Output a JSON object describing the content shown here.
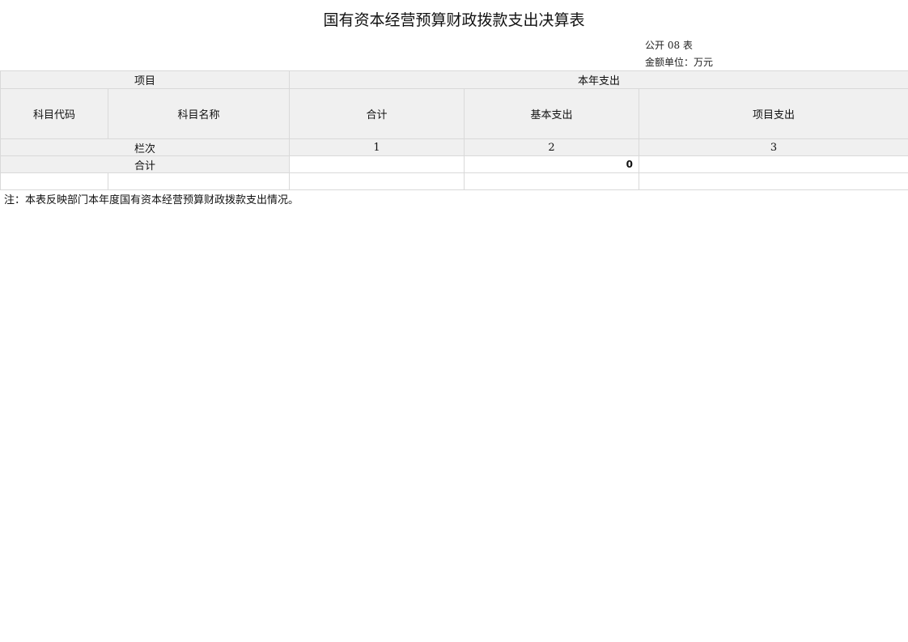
{
  "title": "国有资本经营预算财政拨款支出决算表",
  "form_no": "公开 08 表",
  "unit": "金额单位：万元",
  "table": {
    "header_project": "项目",
    "header_current_year_expenditure": "本年支出",
    "col_subject_code": "科目代码",
    "col_subject_name": "科目名称",
    "col_total": "合计",
    "col_basic": "基本支出",
    "col_project": "项目支出",
    "row_lanci_label": "栏次",
    "lanci": [
      "1",
      "2",
      "3"
    ],
    "total_row_label": "合计",
    "total_row_values": [
      "",
      "0",
      ""
    ]
  },
  "note": "注：本表反映部门本年度国有资本经营预算财政拨款支出情况。"
}
